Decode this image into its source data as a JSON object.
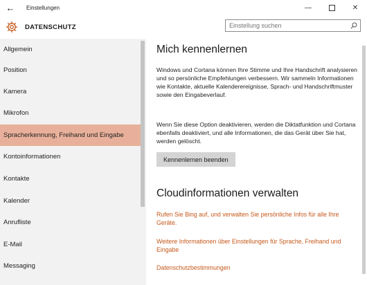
{
  "window": {
    "title": "Einstellungen",
    "back_glyph": "←",
    "minimize_glyph": "—",
    "close_glyph": "✕"
  },
  "header": {
    "title": "DATENSCHUTZ",
    "icon": "gear-icon",
    "search_placeholder": "Einstellung suchen"
  },
  "sidebar": {
    "items": [
      {
        "label": "Allgemein",
        "active": false
      },
      {
        "label": "Position",
        "active": false
      },
      {
        "label": "Kamera",
        "active": false
      },
      {
        "label": "Mikrofon",
        "active": false
      },
      {
        "label": "Spracherkennung, Freihand und Eingabe",
        "active": true
      },
      {
        "label": "Kontoinformationen",
        "active": false
      },
      {
        "label": "Kontakte",
        "active": false
      },
      {
        "label": "Kalender",
        "active": false
      },
      {
        "label": "Anrufliste",
        "active": false
      },
      {
        "label": "E-Mail",
        "active": false
      },
      {
        "label": "Messaging",
        "active": false
      }
    ]
  },
  "main": {
    "section1_title": "Mich kennenlernen",
    "section1_para1": "Windows und Cortana können Ihre Stimme und Ihre Handschrift analysieren und so persönliche Empfehlungen verbessern. Wir sammeln Informationen wie Kontakte, aktuelle Kalenderereignisse, Sprach- und Handschriftmuster sowie den Eingabeverlauf.",
    "section1_para2": "Wenn Sie diese Option deaktivieren, werden die Diktatfunktion und Cortana ebenfalls deaktiviert, und alle Informationen, die das Gerät über Sie hat, werden gelöscht.",
    "stop_button": "Kennenlernen beenden",
    "section2_title": "Cloudinformationen verwalten",
    "link1": "Rufen Sie Bing auf, und verwalten Sie persönliche Infos für alle Ihre Geräte.",
    "link2": "Weitere Informationen über Einstellungen für Sprache, Freihand und Eingabe",
    "link3": "Datenschutzbestimmungen"
  },
  "colors": {
    "accent": "#c4581a",
    "active_item": "#e8b09a",
    "sidebar_bg": "#f2f2f2"
  }
}
